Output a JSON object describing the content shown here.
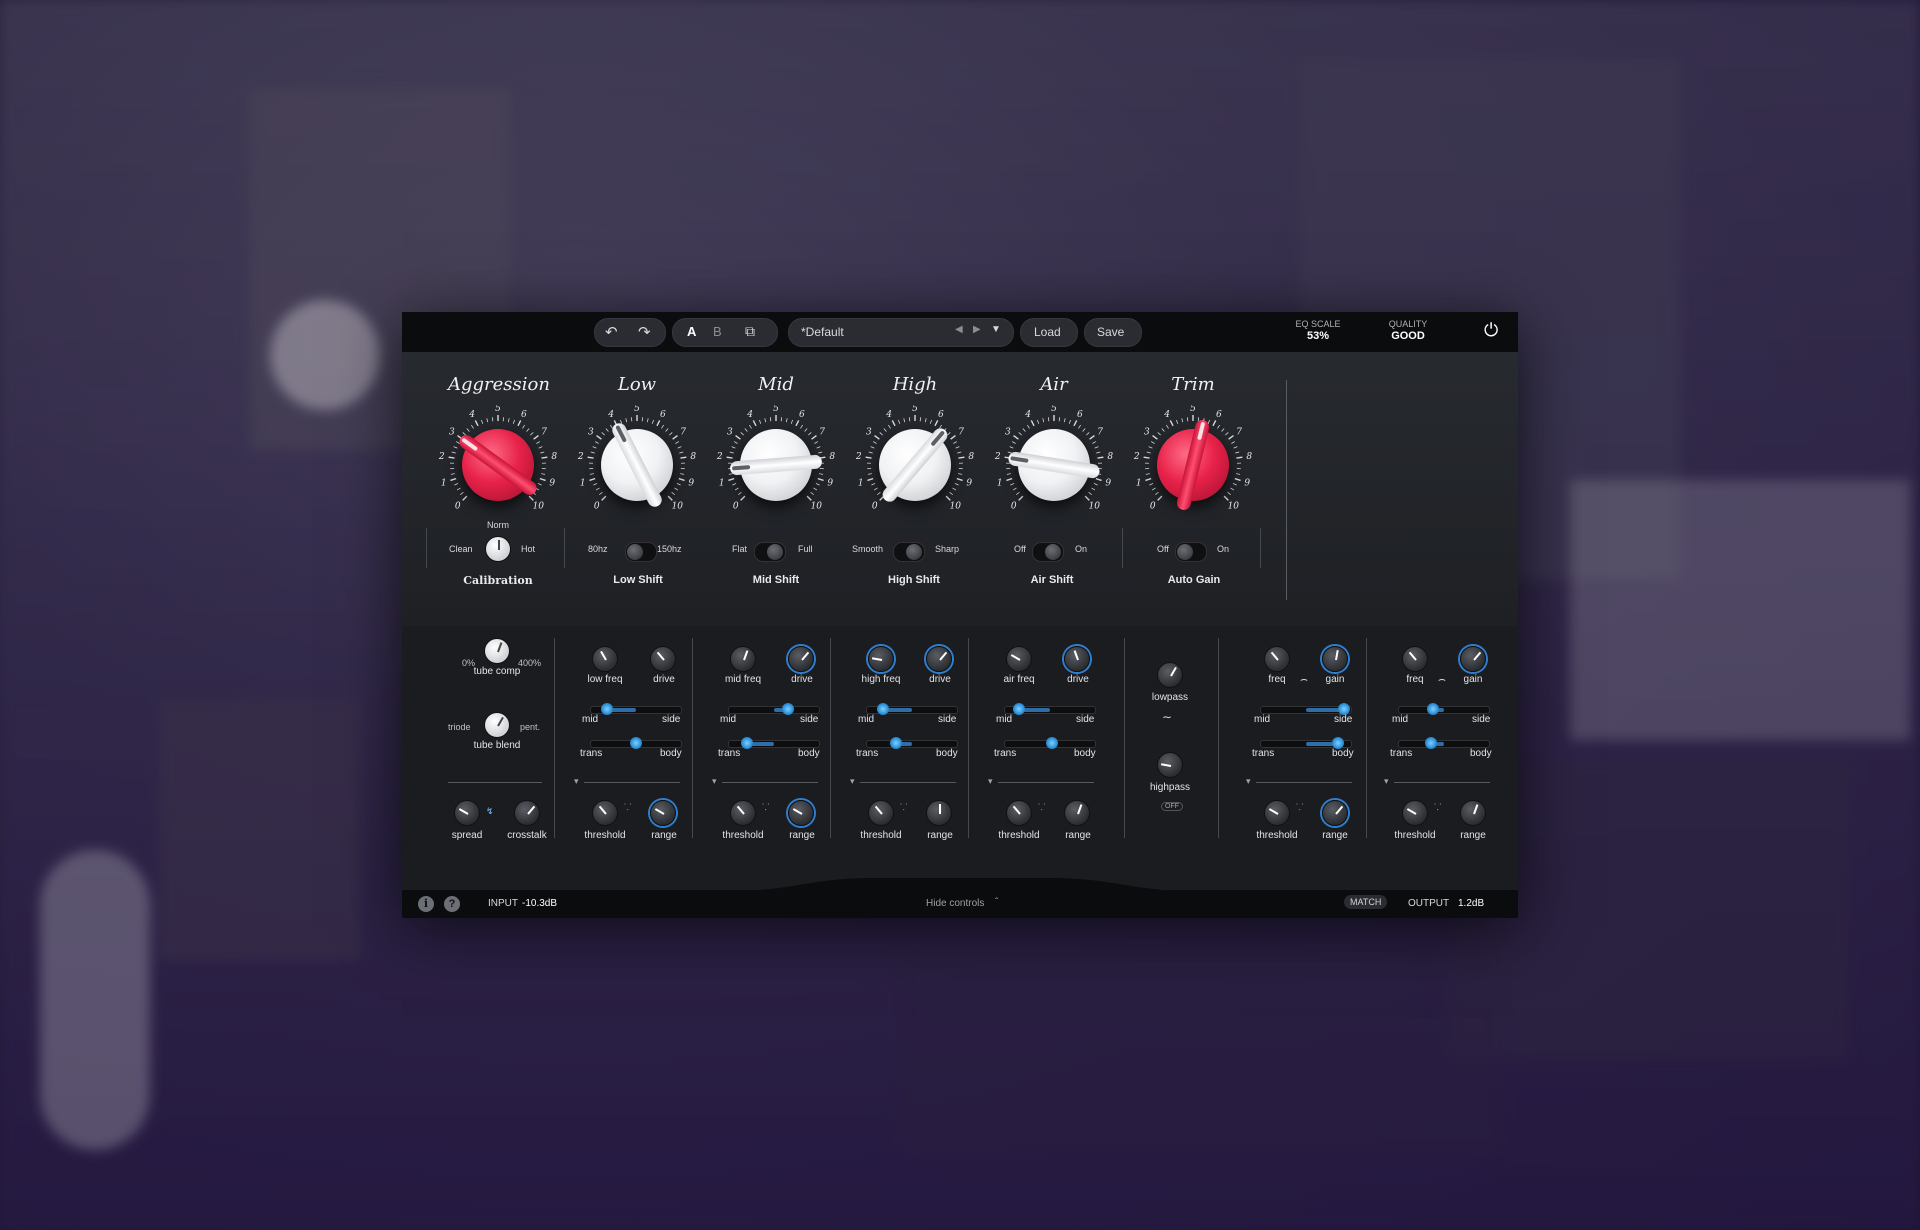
{
  "toolbar": {
    "undo_icon": "undo-icon",
    "redo_icon": "redo-icon",
    "ab_a": "A",
    "ab_b": "B",
    "copy_icon": "copy-icon",
    "preset_name": "*Default",
    "prev_icon": "chevron-left-icon",
    "next_icon": "chevron-right-icon",
    "dropdown_icon": "chevron-down-icon",
    "load_label": "Load",
    "save_label": "Save",
    "eq_scale_label": "EQ SCALE",
    "eq_scale_value": "53%",
    "quality_label": "QUALITY",
    "quality_value": "GOOD",
    "power_icon": "power-icon"
  },
  "main_knobs": [
    {
      "title": "Aggression",
      "color": "#e8224a",
      "value": 3.0
    },
    {
      "title": "Low",
      "color": "#ffffff",
      "value": 4.0
    },
    {
      "title": "Mid",
      "color": "#ffffff",
      "value": 1.5
    },
    {
      "title": "High",
      "color": "#ffffff",
      "value": 6.5
    },
    {
      "title": "Air",
      "color": "#ffffff",
      "value": 2.0
    },
    {
      "title": "Trim",
      "color": "#e8224a",
      "value": 5.5
    }
  ],
  "dial_numbers": [
    "0",
    "1",
    "2",
    "3",
    "4",
    "5",
    "6",
    "7",
    "8",
    "9",
    "10"
  ],
  "switches": [
    {
      "name": "Calibration",
      "left": "Clean",
      "right": "Hot",
      "top": "Norm"
    },
    {
      "name": "Low Shift",
      "left": "80hz",
      "right": "150hz"
    },
    {
      "name": "Mid Shift",
      "left": "Flat",
      "right": "Full"
    },
    {
      "name": "High Shift",
      "left": "Smooth",
      "right": "Sharp"
    },
    {
      "name": "Air Shift",
      "left": "Off",
      "right": "On"
    },
    {
      "name": "Auto Gain",
      "left": "Off",
      "right": "On"
    }
  ],
  "tube": {
    "comp_label": "tube comp",
    "comp_min": "0%",
    "comp_max": "400%",
    "blend_label": "tube blend",
    "blend_left": "triode",
    "blend_right": "pent.",
    "spread_label": "spread",
    "crosstalk_label": "crosstalk"
  },
  "bands": [
    {
      "freq_label": "low freq",
      "drive_label": "drive",
      "mid_side": 0.18,
      "trans_body": 0.5
    },
    {
      "freq_label": "mid freq",
      "drive_label": "drive",
      "mid_side": 0.65,
      "trans_body": 0.2
    },
    {
      "freq_label": "high freq",
      "drive_label": "drive",
      "mid_side": 0.18,
      "trans_body": 0.32
    },
    {
      "freq_label": "air freq",
      "drive_label": "drive",
      "mid_side": 0.15,
      "trans_body": 0.52
    }
  ],
  "band_labels": {
    "mid": "mid",
    "side": "side",
    "trans": "trans",
    "body": "body",
    "threshold": "threshold",
    "range": "range"
  },
  "filters": {
    "lowpass": "lowpass",
    "highpass": "highpass",
    "off": "OFF"
  },
  "eq_bands": [
    {
      "freq": "freq",
      "gain": "gain",
      "mid_side": 0.92,
      "trans_body": 0.86
    },
    {
      "freq": "freq",
      "gain": "gain",
      "mid_side": 0.38,
      "trans_body": 0.35
    }
  ],
  "footer": {
    "info_icon": "info-icon",
    "help_icon": "help-icon",
    "input_label": "INPUT",
    "input_value": "-10.3dB",
    "hide_controls": "Hide controls",
    "match_label": "MATCH",
    "output_label": "OUTPUT",
    "output_value": "1.2dB"
  }
}
